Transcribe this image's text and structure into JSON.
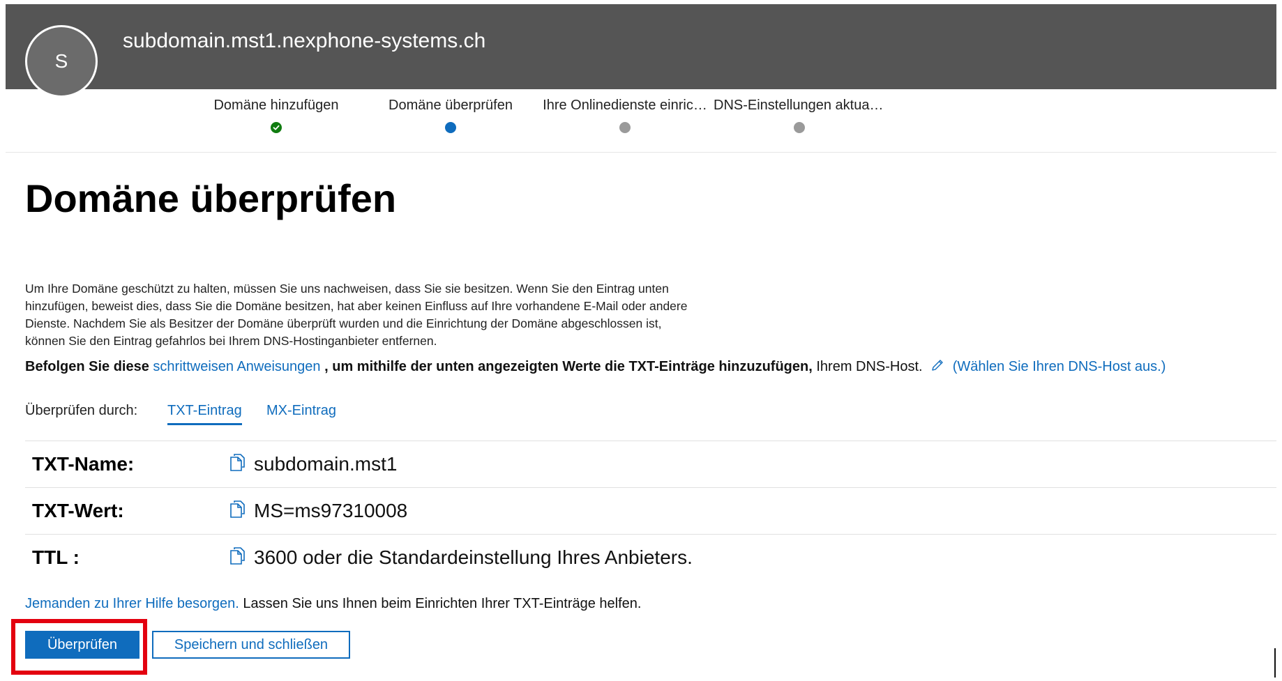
{
  "header": {
    "avatar_initial": "S",
    "domain": "subdomain.mst1.nexphone-systems.ch"
  },
  "steps": [
    {
      "label": "Domäne hinzufügen",
      "status": "done"
    },
    {
      "label": "Domäne überprüfen",
      "status": "current"
    },
    {
      "label": "Ihre Onlinedienste einric…",
      "status": "pending"
    },
    {
      "label": "DNS-Einstellungen aktual…",
      "status": "pending"
    }
  ],
  "main": {
    "title": "Domäne überprüfen",
    "intro": "Um Ihre Domäne geschützt zu halten, müssen Sie uns nachweisen, dass Sie sie besitzen. Wenn Sie den Eintrag unten hinzufügen, beweist dies, dass Sie die Domäne besitzen, hat aber keinen Einfluss auf Ihre vorhandene E-Mail oder andere Dienste. Nachdem Sie als Besitzer der Domäne überprüft wurden und die Einrichtung der Domäne abgeschlossen ist, können Sie den Eintrag gefahrlos bei Ihrem DNS-Hostinganbieter entfernen.",
    "instructions": {
      "prefix": "Befolgen Sie diese",
      "link": "schrittweisen Anweisungen",
      "middle": ", um mithilfe der unten angezeigten Werte die TXT-Einträge hinzuzufügen,",
      "suffix": "Ihrem DNS-Host.",
      "choose_host_link": "(Wählen Sie Ihren DNS-Host aus.)"
    },
    "verify_by": {
      "label": "Überprüfen durch:",
      "tabs": [
        "TXT-Eintrag",
        "MX-Eintrag"
      ],
      "active_tab": "TXT-Eintrag"
    },
    "records": [
      {
        "key": "TXT-Name:",
        "value": "subdomain.mst1"
      },
      {
        "key": "TXT-Wert:",
        "value": "MS=ms97310008"
      },
      {
        "key": "TTL :",
        "value": "3600 oder die Standardeinstellung Ihres Anbieters."
      }
    ],
    "help": {
      "link": "Jemanden zu Ihrer Hilfe besorgen.",
      "text": "Lassen Sie uns Ihnen beim Einrichten Ihrer TXT-Einträge helfen."
    },
    "buttons": {
      "verify": "Überprüfen",
      "save_close": "Speichern und schließen"
    }
  },
  "colors": {
    "header_bg": "#555555",
    "accent": "#0f6cbd",
    "done": "#107c10",
    "pending": "#9a9a9a",
    "highlight": "#e3000f"
  }
}
